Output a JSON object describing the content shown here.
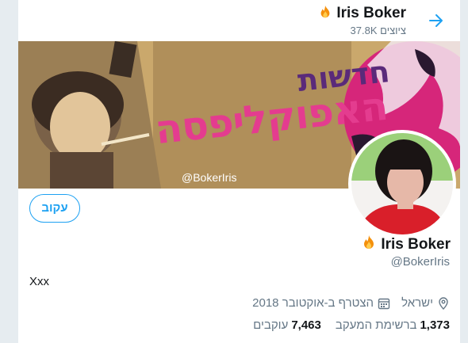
{
  "header": {
    "display_name": "Iris Boker",
    "tweet_count": "37.8K",
    "tweet_label": "ציוצים"
  },
  "banner": {
    "title_line1": "חדשות",
    "title_line2": "האפוקליפסה",
    "handle": "@BokerIris"
  },
  "profile": {
    "follow_label": "עקוב",
    "name": "Iris Boker",
    "handle": "@BokerIris",
    "bio": "Xxx",
    "location": "ישראל",
    "joined": "הצטרף ב-אוקטובר 2018",
    "following_count": "1,373",
    "following_label": "ברשימת המעקב",
    "followers_count": "7,463",
    "followers_label": "עוקבים"
  },
  "colors": {
    "accent": "#1da1f2",
    "muted": "#657786",
    "banner_magenta": "#d6267a"
  },
  "icons": [
    "back-arrow-icon",
    "fire-emoji-icon",
    "location-icon",
    "calendar-icon"
  ]
}
